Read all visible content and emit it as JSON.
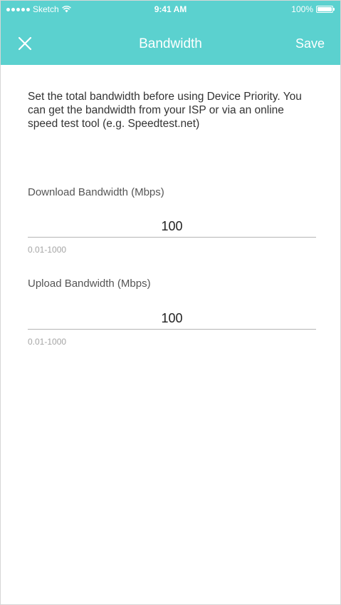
{
  "status_bar": {
    "carrier": "Sketch",
    "time": "9:41 AM",
    "battery": "100%",
    "battery_level": 1.0
  },
  "header": {
    "title": "Bandwidth",
    "save_label": "Save",
    "background_color": "#5bd1cf"
  },
  "description": "Set the total bandwidth before using Device Priority. You can get the bandwidth from your ISP or via an online speed test tool (e.g. Speedtest.net)",
  "download": {
    "label": "Download Bandwidth (Mbps)",
    "value": "100",
    "hint": "0.01-1000"
  },
  "upload": {
    "label": "Upload Bandwidth (Mbps)",
    "value": "100",
    "hint": "0.01-1000"
  },
  "icons": {
    "close": "close-icon",
    "wifi": "wifi-icon",
    "battery": "battery-icon",
    "signal": "signal-dots-icon"
  }
}
